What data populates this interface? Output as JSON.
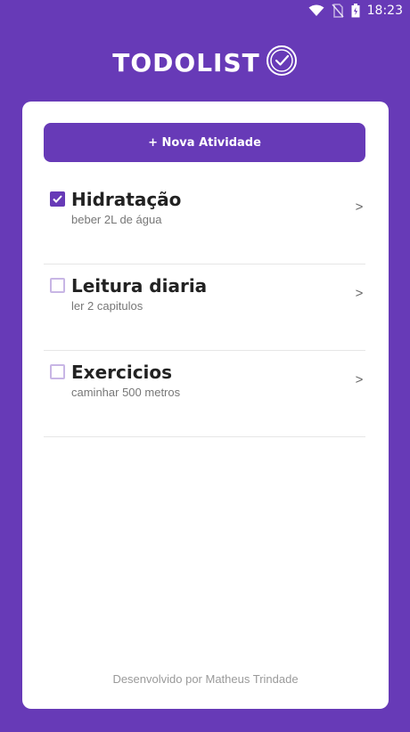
{
  "status_bar": {
    "time": "18:23",
    "icons": [
      "wifi-icon",
      "no-sim-icon",
      "battery-icon"
    ]
  },
  "logo": {
    "text": "TODOLIST",
    "icon": "check-circle-icon"
  },
  "colors": {
    "primary": "#673AB7",
    "card": "#FFFFFF"
  },
  "new_button_label": "+ Nova Atividade",
  "tasks": [
    {
      "title": "Hidratação",
      "subtitle": "beber 2L de água",
      "checked": true,
      "arrow": ">"
    },
    {
      "title": "Leitura diaria",
      "subtitle": "ler 2 capitulos",
      "checked": false,
      "arrow": ">"
    },
    {
      "title": "Exercicios",
      "subtitle": "caminhar 500 metros",
      "checked": false,
      "arrow": ">"
    }
  ],
  "footer": "Desenvolvido por Matheus Trindade"
}
